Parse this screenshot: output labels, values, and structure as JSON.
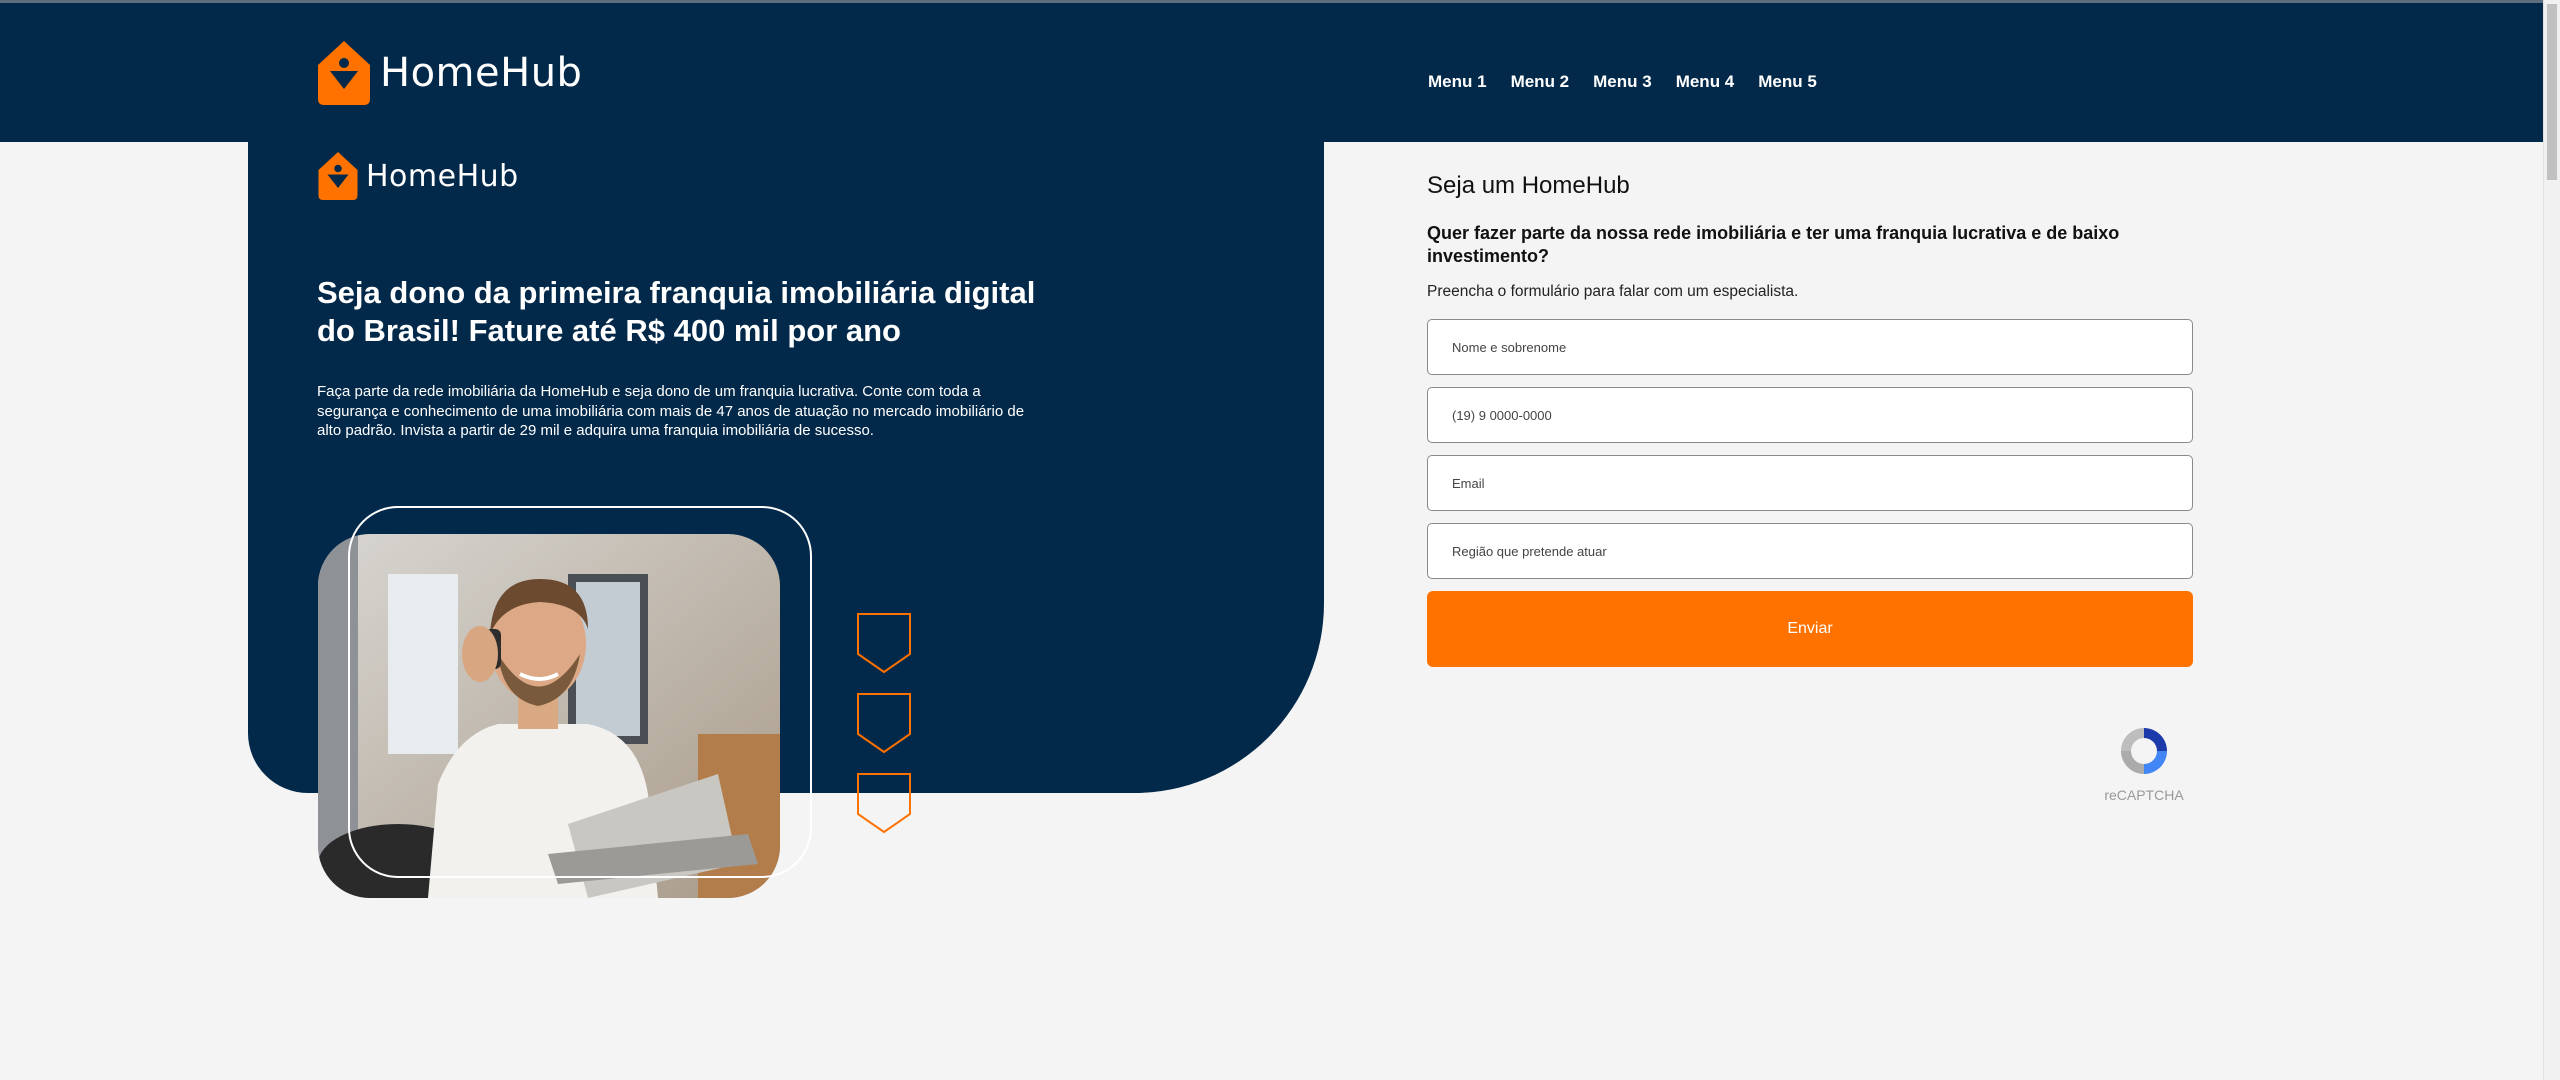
{
  "brand": {
    "name": "HomeHub",
    "primary_color": "#03294a",
    "accent_color": "#ff7200"
  },
  "nav": {
    "items": [
      "Menu 1",
      "Menu 2",
      "Menu 3",
      "Menu 4",
      "Menu 5"
    ]
  },
  "hero": {
    "logo_text": "HomeHub",
    "title": "Seja dono da primeira franquia imobiliária digital do Brasil! Fature até R$ 400 mil por ano",
    "description": "Faça parte da rede imobiliária da HomeHub e seja dono de um franquia lucrativa. Conte com toda a segurança e conhecimento de uma imobiliária com mais de 47 anos de atuação no mercado imobiliário de alto padrão. Invista a partir de 29 mil e adquira uma franquia imobiliária de sucesso.",
    "image": "man-on-phone-with-laptop-photo"
  },
  "form": {
    "title": "Seja um HomeHub",
    "subtitle": "Quer fazer parte da nossa rede imobiliária e ter uma franquia lucrativa e de baixo investimento?",
    "description": "Preencha o formulário para falar com um especialista.",
    "fields": [
      {
        "placeholder": "Nome e sobrenome"
      },
      {
        "placeholder": "(19) 9 0000-0000"
      },
      {
        "placeholder": "Email"
      },
      {
        "placeholder": "Região que pretende atuar"
      }
    ],
    "submit_label": "Enviar",
    "recaptcha_label": "reCAPTCHA"
  }
}
